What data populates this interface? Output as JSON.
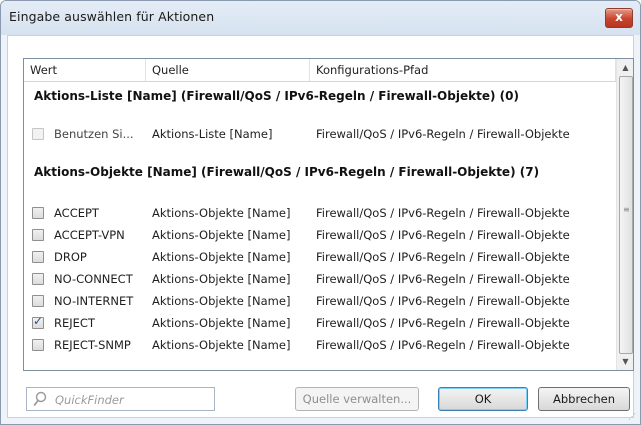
{
  "window": {
    "title": "Eingabe auswählen für Aktionen",
    "close_label": "x"
  },
  "table": {
    "columns": [
      "Wert",
      "Quelle",
      "Konfigurations-Pfad"
    ],
    "groups": [
      {
        "title": "Aktions-Liste [Name] (Firewall/QoS / IPv6-Regeln / Firewall-Objekte) (0)",
        "rows": [
          {
            "value": "Benutzen Si...",
            "source": "Aktions-Liste [Name]",
            "path": "Firewall/QoS / IPv6-Regeln / Firewall-Objekte",
            "checked": false,
            "disabled": true
          }
        ]
      },
      {
        "title": "Aktions-Objekte [Name] (Firewall/QoS / IPv6-Regeln / Firewall-Objekte) (7)",
        "rows": [
          {
            "value": "ACCEPT",
            "source": "Aktions-Objekte [Name]",
            "path": "Firewall/QoS / IPv6-Regeln / Firewall-Objekte",
            "checked": false,
            "disabled": false
          },
          {
            "value": "ACCEPT-VPN",
            "source": "Aktions-Objekte [Name]",
            "path": "Firewall/QoS / IPv6-Regeln / Firewall-Objekte",
            "checked": false,
            "disabled": false
          },
          {
            "value": "DROP",
            "source": "Aktions-Objekte [Name]",
            "path": "Firewall/QoS / IPv6-Regeln / Firewall-Objekte",
            "checked": false,
            "disabled": false
          },
          {
            "value": "NO-CONNECT",
            "source": "Aktions-Objekte [Name]",
            "path": "Firewall/QoS / IPv6-Regeln / Firewall-Objekte",
            "checked": false,
            "disabled": false
          },
          {
            "value": "NO-INTERNET",
            "source": "Aktions-Objekte [Name]",
            "path": "Firewall/QoS / IPv6-Regeln / Firewall-Objekte",
            "checked": false,
            "disabled": false
          },
          {
            "value": "REJECT",
            "source": "Aktions-Objekte [Name]",
            "path": "Firewall/QoS / IPv6-Regeln / Firewall-Objekte",
            "checked": true,
            "disabled": false
          },
          {
            "value": "REJECT-SNMP",
            "source": "Aktions-Objekte [Name]",
            "path": "Firewall/QoS / IPv6-Regeln / Firewall-Objekte",
            "checked": false,
            "disabled": false
          }
        ]
      }
    ]
  },
  "footer": {
    "search_placeholder": "QuickFinder",
    "manage_sources_label": "Quelle verwalten...",
    "ok_label": "OK",
    "cancel_label": "Abbrechen"
  },
  "icons": {
    "search": "search-icon",
    "close": "close-icon",
    "checkmark": "checkmark-icon",
    "scroll_up": "chevron-up-icon",
    "scroll_down": "chevron-down-icon"
  }
}
